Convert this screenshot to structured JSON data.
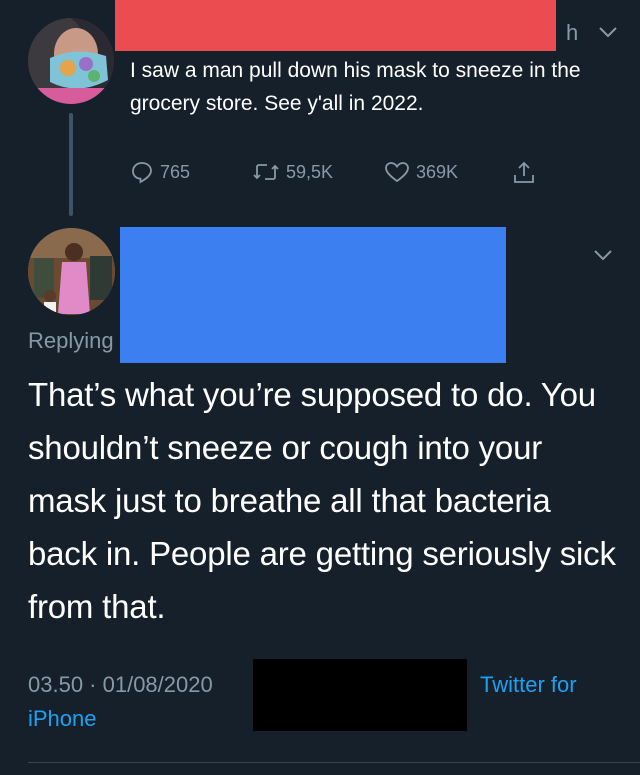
{
  "tweet1": {
    "handle_tail": "h",
    "text": "I saw a man pull down his mask to sneeze in the grocery store. See y'all in 2022.",
    "actions": {
      "reply_count": "765",
      "retweet_count": "59,5K",
      "like_count": "369K"
    },
    "icons": [
      "reply-icon",
      "retweet-icon",
      "heart-icon",
      "share-icon",
      "chevron-down-icon"
    ]
  },
  "tweet2": {
    "replying_label": "Replying",
    "text": "That’s what you’re supposed to do. You shouldn’t sneeze or cough into your mask just to breathe all that bacteria back in. People are getting seriously sick from that.",
    "time": "03.50 · 01/08/2020",
    "source_part1": "Twitter for",
    "source_part2": "iPhone"
  },
  "colors": {
    "background": "#15202b",
    "muted": "#8899a6",
    "link": "#1da1f2",
    "redact_red": "#ea4c4f",
    "redact_blue": "#3c7ff0",
    "redact_black": "#000000"
  }
}
